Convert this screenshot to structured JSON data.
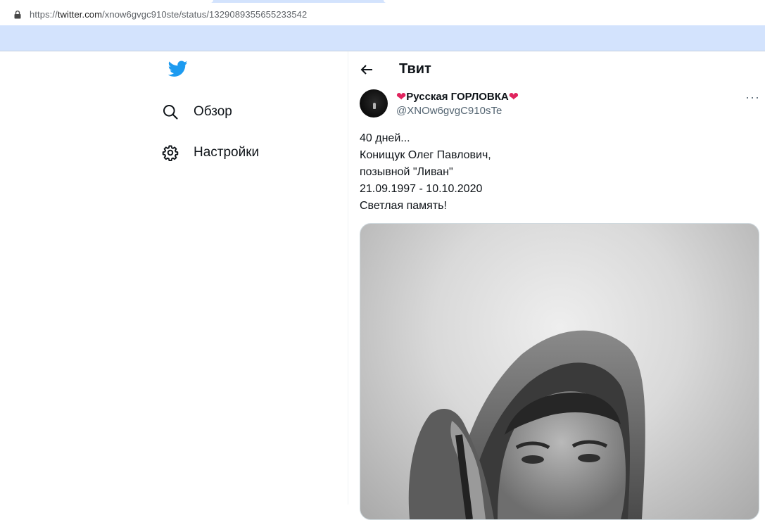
{
  "browser": {
    "url_prefix": "https://",
    "url_host": "twitter.com",
    "url_path": "/xnow6gvgc910ste/status/1329089355655233542"
  },
  "sidebar": {
    "explore_label": "Обзор",
    "settings_label": "Настройки"
  },
  "header": {
    "title": "Твит"
  },
  "tweet": {
    "author_name": "Русская ГОРЛОВКА",
    "author_handle": "@XNOw6gvgC910sTe",
    "text": "40 дней...\nКонищук Олег Павлович,\nпозывной \"Ливан\"\n21.09.1997 - 10.10.2020\nСветлая память!",
    "name_emoji": "❤",
    "more_label": "···"
  },
  "colors": {
    "brand": "#1d9bf0",
    "text_primary": "#0f1419",
    "text_secondary": "#536471",
    "heart": "#e0245e",
    "browser_chrome": "#d3e3fd"
  },
  "icons": {
    "logo": "twitter-bird-icon",
    "explore": "search-icon",
    "settings": "gear-icon",
    "back": "back-arrow-icon",
    "more": "more-options-icon",
    "lock": "lock-icon"
  }
}
